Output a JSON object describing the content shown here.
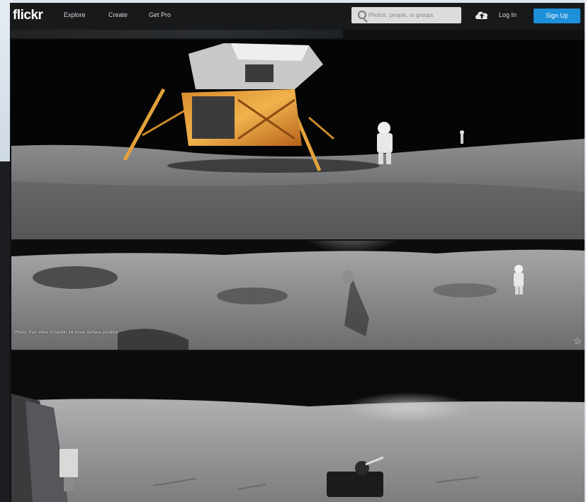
{
  "brand": {
    "logo": "flickr"
  },
  "nav": {
    "explore": "Explore",
    "create": "Create",
    "get_pro": "Get Pro"
  },
  "search": {
    "placeholder": "Photos, people, or groups"
  },
  "auth": {
    "login": "Log In",
    "signup": "Sign Up"
  },
  "colors": {
    "topbar": "#17191b",
    "signup_button": "#1e8fd9"
  },
  "icons": {
    "search": "search-icon",
    "upload": "cloud-upload-icon",
    "favorite": "star-icon"
  },
  "photos": [
    {
      "caption": ""
    },
    {
      "caption": "Photo: Pan View of Apollo 16 lunar surface position"
    },
    {
      "caption": ""
    }
  ]
}
